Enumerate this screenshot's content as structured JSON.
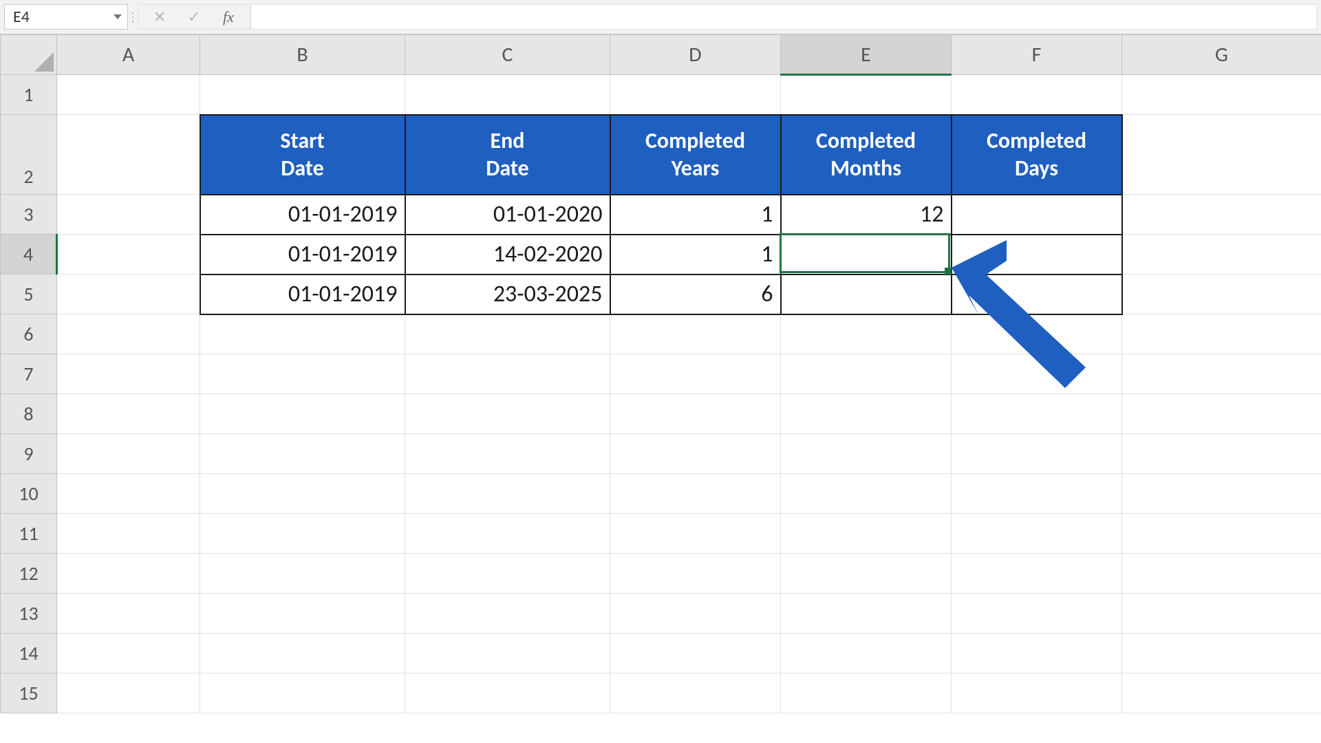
{
  "formula_bar": {
    "name_box": "E4",
    "formula": ""
  },
  "columns": [
    "A",
    "B",
    "C",
    "D",
    "E",
    "F",
    "G"
  ],
  "rows": [
    "1",
    "2",
    "3",
    "4",
    "5",
    "6",
    "7",
    "8",
    "9",
    "10",
    "11",
    "12",
    "13",
    "14",
    "15"
  ],
  "selected_cell": "E4",
  "table": {
    "headers": {
      "B": "Start\nDate",
      "C": "End\nDate",
      "D": "Completed\nYears",
      "E": "Completed\nMonths",
      "F": "Completed\nDays"
    },
    "rows": [
      {
        "B": "01-01-2019",
        "C": "01-01-2020",
        "D": "1",
        "E": "12",
        "F": ""
      },
      {
        "B": "01-01-2019",
        "C": "14-02-2020",
        "D": "1",
        "E": "",
        "F": ""
      },
      {
        "B": "01-01-2019",
        "C": "23-03-2025",
        "D": "6",
        "E": "",
        "F": ""
      }
    ]
  },
  "icons": {
    "cancel": "✕",
    "enter": "✓",
    "fx": "fx"
  },
  "annotation": {
    "arrow_color": "#1f5fbf"
  }
}
